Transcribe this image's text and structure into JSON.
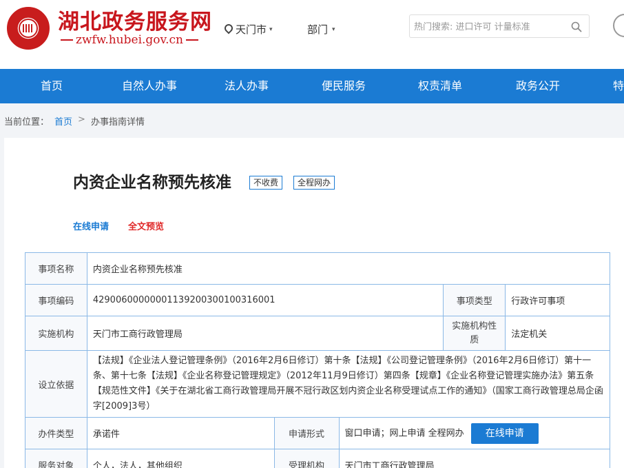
{
  "header": {
    "site_title": "湖北政务服务网",
    "site_url": "zwfw.hubei.gov.cn",
    "location": "天门市",
    "department": "部门",
    "search_placeholder": "热门搜索: 进口许可 计量标准"
  },
  "nav": {
    "items": [
      "首页",
      "自然人办事",
      "法人办事",
      "便民服务",
      "权责清单",
      "政务公开",
      "特"
    ]
  },
  "breadcrumb": {
    "prefix": "当前位置：",
    "home": "首页",
    "separator": ">",
    "current": "办事指南详情"
  },
  "item": {
    "title": "内资企业名称预先核准",
    "tags": [
      "不收费",
      "全程网办"
    ],
    "actions": {
      "apply": "在线申请",
      "preview": "全文预览"
    }
  },
  "table": {
    "name_label": "事项名称",
    "name_value": "内资企业名称预先核准",
    "code_label": "事项编码",
    "code_value": "429006000000011392003001003160​01",
    "type_label": "事项类型",
    "type_value": "行政许可事项",
    "org_label": "实施机构",
    "org_value": "天门市工商行政管理局",
    "org_nature_label": "实施机构性质",
    "org_nature_value": "法定机关",
    "basis_label": "设立依据",
    "basis_value": "【法规】《企业法人登记管理条例》（2016年2月6日修订）第十条【法规】《公司登记管理条例》（2016年2月6日修订）第十一条、第十七条【法规】《企业名称登记管理规定》（2012年11月9日修订）第四条【规章】《企业名称登记管理实施办法》第五条【规范性文件】《关于在湖北省工商行政管理局开展不冠行政区划内资企业名称受理试点工作的通知》（国家工商行政管理总局企函字[2009]3号）",
    "handle_type_label": "办件类型",
    "handle_type_value": "承诺件",
    "apply_form_label": "申请形式",
    "apply_form_value": "窗口申请；网上申请  全程网办",
    "apply_button": "在线申请",
    "target_label": "服务对象",
    "target_value": "个人，法人，其他组织",
    "accept_org_label": "受理机构",
    "accept_org_value": "天门市工商行政管理局"
  }
}
